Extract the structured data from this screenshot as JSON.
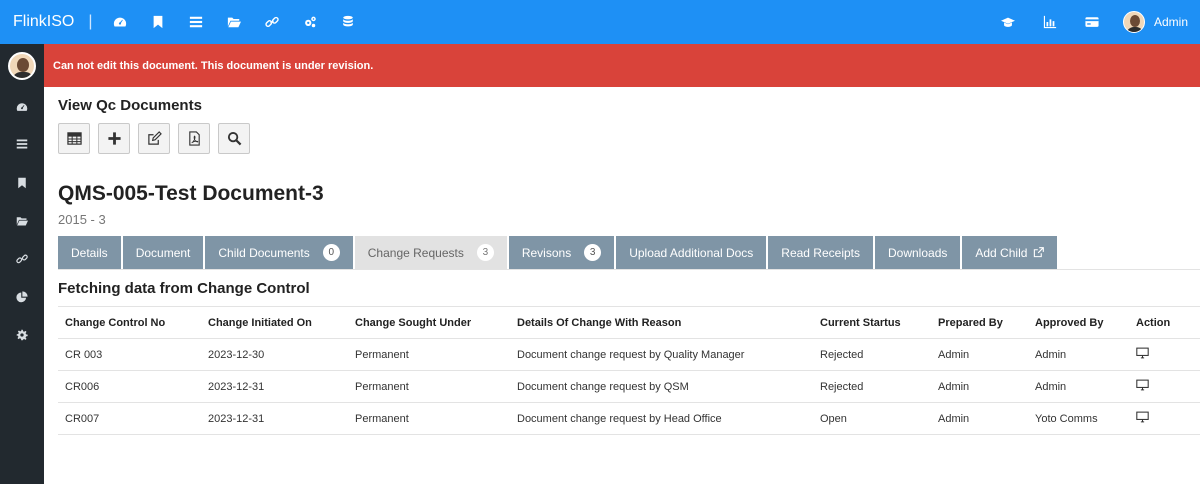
{
  "topbar": {
    "brand": "FlinkISO",
    "separator": "|",
    "icons": [
      "dashboard-icon",
      "bookmark-icon",
      "list-icon",
      "folder-open-icon",
      "link-icon",
      "cogs-icon",
      "database-icon"
    ],
    "right_icons": [
      "graduation-cap-icon",
      "bar-chart-icon",
      "credit-card-icon"
    ],
    "user_label": "Admin",
    "color": "#1e90f5"
  },
  "sidebar": {
    "icons": [
      "dashboard-icon",
      "list-icon",
      "bookmark-icon",
      "folder-open-icon",
      "link-icon",
      "pie-chart-icon",
      "gear-icon"
    ],
    "color": "#22292f"
  },
  "alert": {
    "message": "Can not edit this document. This document is under revision.",
    "color": "#d9433a"
  },
  "main": {
    "section_title": "View Qc Documents",
    "toolbar": [
      "table-icon",
      "plus-icon",
      "edit-icon",
      "pdf-icon",
      "search-icon"
    ],
    "doc_title": "QMS-005-Test Document-3",
    "doc_subtitle": "2015 - 3",
    "tabs": [
      {
        "label": "Details",
        "badge": null
      },
      {
        "label": "Document",
        "badge": null
      },
      {
        "label": "Child Documents",
        "badge": "0"
      },
      {
        "label": "Change Requests",
        "badge": "3",
        "active": true
      },
      {
        "label": "Revisons",
        "badge": "3"
      },
      {
        "label": "Upload Additional Docs",
        "badge": null
      },
      {
        "label": "Read Receipts",
        "badge": null
      },
      {
        "label": "Downloads",
        "badge": null
      },
      {
        "label": "Add Child",
        "badge": null,
        "icon": "external-link-icon"
      }
    ],
    "table_title": "Fetching data from Change Control",
    "table": {
      "headers": [
        "Change Control No",
        "Change Initiated On",
        "Change Sought Under",
        "Details Of Change With Reason",
        "Current Startus",
        "Prepared By",
        "Approved By",
        "Action"
      ],
      "rows": [
        [
          "CR 003",
          "2023-12-30",
          "Permanent",
          "Document change request by Quality Manager",
          "Rejected",
          "Admin",
          "Admin"
        ],
        [
          "CR006",
          "2023-12-31",
          "Permanent",
          "Document change request by QSM",
          "Rejected",
          "Admin",
          "Admin"
        ],
        [
          "CR007",
          "2023-12-31",
          "Permanent",
          "Document change request by Head Office",
          "Open",
          "Admin",
          "Yoto Comms"
        ]
      ],
      "action_icon": "desktop-icon"
    }
  }
}
